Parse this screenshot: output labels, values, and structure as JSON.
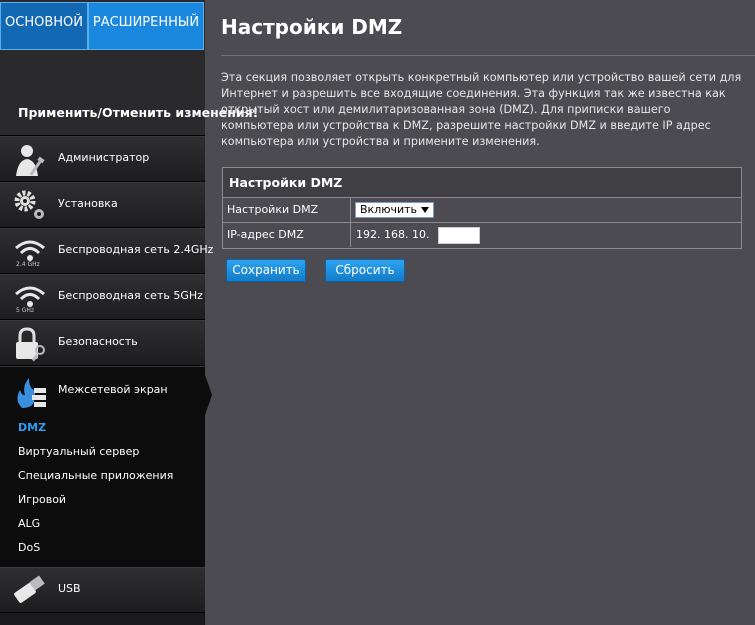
{
  "tabs": {
    "basic": "ОСНОВНОЙ",
    "advanced": "РАСШИРЕННЫЙ"
  },
  "apply_link": "Применить/Отменить изменения!",
  "nav": {
    "admin": "Администратор",
    "setup": "Установка",
    "wifi24": "Беспроводная сеть 2.4GHz",
    "wifi24_sub": "2.4 GHz",
    "wifi5": "Беспроводная сеть 5GHz",
    "wifi5_sub": "5 GHz",
    "security": "Безопасность",
    "firewall": "Межсетевой экран",
    "usb": "USB"
  },
  "firewall_sub": [
    "DMZ",
    "Виртуальный сервер",
    "Специальные приложения",
    "Игровой",
    "ALG",
    "DoS"
  ],
  "page": {
    "title": "Настройки DMZ",
    "description": "Эта секция позволяет открыть конкретный компьютер или устройство вашей сети для Интернет и разрешить все входящие соединения. Эта функция так же известна как открытый хост или демилитаризованная зона (DMZ). Для приписки вашего компьютера или устройства к DMZ, разрешите настройки DMZ и введите IP адрес компьютера или устройства и примените изменения."
  },
  "table": {
    "header": "Настройки DMZ",
    "dmz_label": "Настройки DMZ",
    "dmz_value": "Включить",
    "ip_label": "IP-адрес DMZ",
    "ip_prefix": "192. 168. 10.",
    "ip_last": ""
  },
  "buttons": {
    "save": "Сохранить",
    "reset": "Сбросить"
  },
  "colors": {
    "accent": "#1a88df",
    "selected_sub": "#2d9bf0",
    "background": "#4b4b51"
  }
}
